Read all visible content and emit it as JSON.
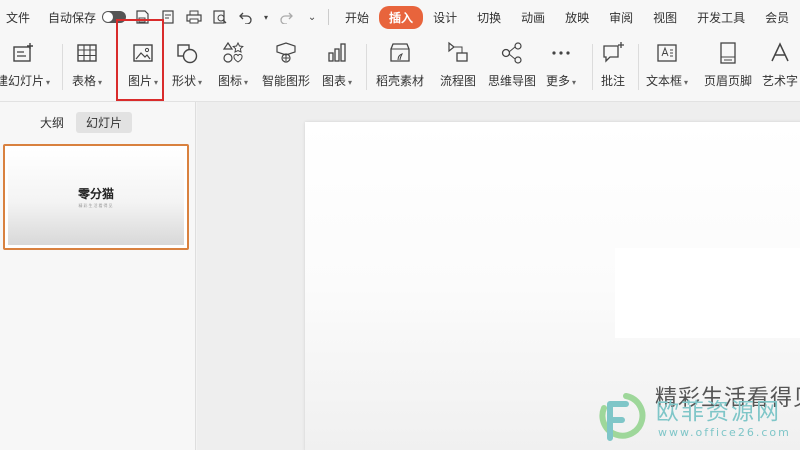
{
  "menubar": {
    "file": "文件",
    "autosave": "自动保存",
    "tabs": [
      "开始",
      "插入",
      "设计",
      "切换",
      "动画",
      "放映",
      "审阅",
      "视图",
      "开发工具",
      "会员"
    ],
    "active_tab": "插入",
    "accent": "#e8643c"
  },
  "ribbon": {
    "new_slide": "建幻灯片",
    "table": "表格",
    "picture": "图片",
    "shape": "形状",
    "icons": "图标",
    "smartart": "智能图形",
    "chart": "图表",
    "material": "稻壳素材",
    "flowchart": "流程图",
    "mindmap": "思维导图",
    "more": "更多",
    "comment": "批注",
    "textbox": "文本框",
    "header_footer": "页眉页脚",
    "wordart": "艺术字"
  },
  "panel": {
    "outline_tab": "大纲",
    "slides_tab": "幻灯片",
    "thumb_title": "零分猫",
    "thumb_subtitle": "精彩生活看得见"
  },
  "slide": {
    "text": "精彩生活看得见"
  },
  "watermark": {
    "name": "欧菲资源网",
    "url": "www.office26.com"
  }
}
